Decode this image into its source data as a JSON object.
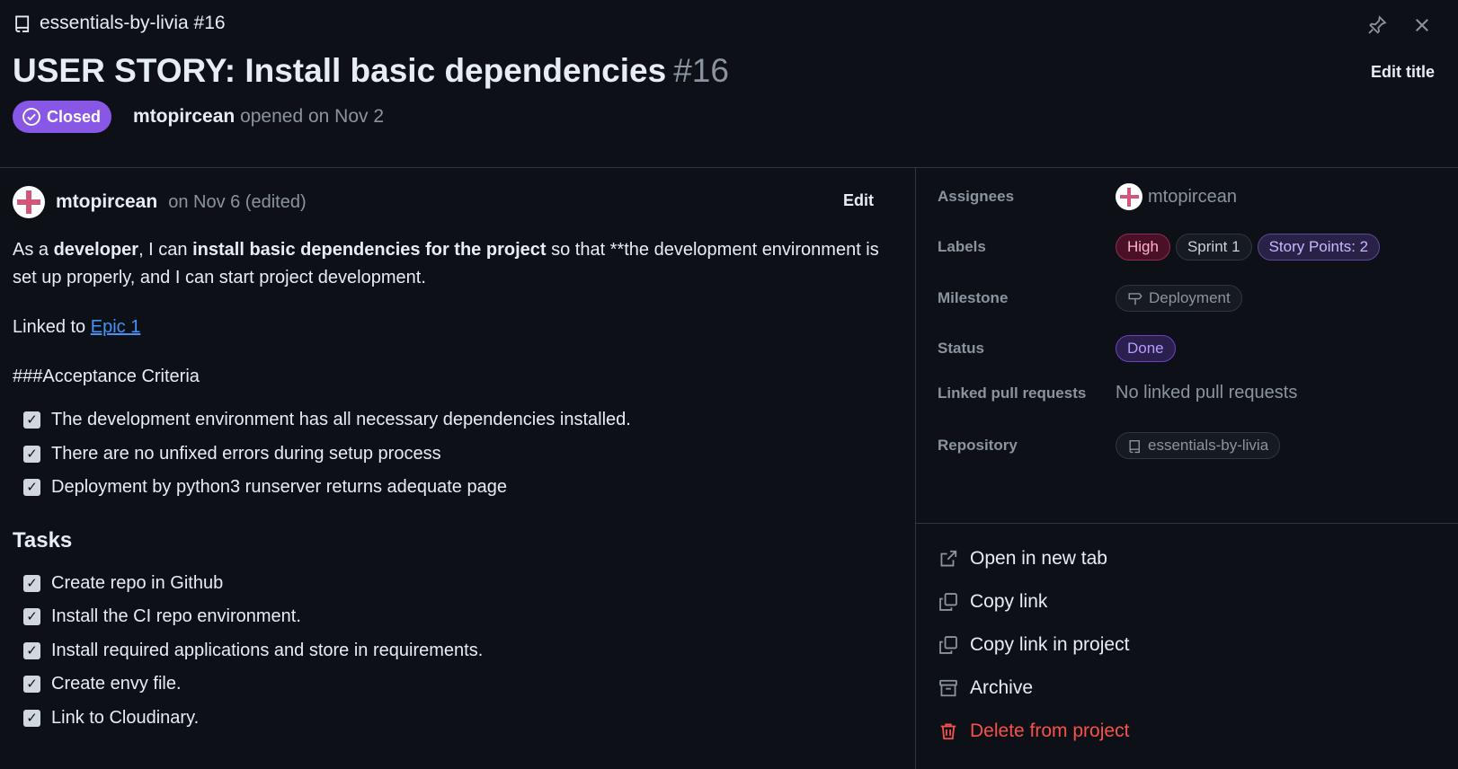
{
  "header": {
    "repo_ref": "essentials-by-livia #16",
    "title": "USER STORY: Install basic dependencies",
    "number": "#16",
    "edit_title": "Edit title",
    "state": "Closed",
    "author": "mtopircean",
    "opened_text": "opened on Nov 2"
  },
  "comment": {
    "author": "mtopircean",
    "date": "on Nov 6 (edited)",
    "edit_label": "Edit",
    "para1": {
      "t1": "As a ",
      "b1": "developer",
      "t2": ", I can ",
      "b2": "install basic dependencies for the project",
      "t3": " so that **the development environment is set up properly, and I can start project development."
    },
    "linked_prefix": "Linked to ",
    "linked_link": "Epic 1",
    "acceptance_heading": "###Acceptance Criteria",
    "criteria": [
      "The development environment has all necessary dependencies installed.",
      "There are no unfixed errors during setup process",
      "Deployment by python3 runserver returns adequate page"
    ],
    "tasks_heading": "Tasks",
    "tasks": [
      "Create repo in Github",
      "Install the CI repo environment.",
      "Install required applications and store in requirements.",
      "Create envy file.",
      "Link to Cloudinary."
    ]
  },
  "sidebar": {
    "assignees_label": "Assignees",
    "assignee": "mtopircean",
    "labels_label": "Labels",
    "labels": [
      "High",
      "Sprint 1",
      "Story Points: 2"
    ],
    "milestone_label": "Milestone",
    "milestone": "Deployment",
    "status_label": "Status",
    "status": "Done",
    "prs_label": "Linked pull requests",
    "prs_value": "No linked pull requests",
    "repo_label": "Repository",
    "repo": "essentials-by-livia"
  },
  "actions": [
    {
      "label": "Open in new tab",
      "icon": "external-link-icon"
    },
    {
      "label": "Copy link",
      "icon": "copy-icon"
    },
    {
      "label": "Copy link in project",
      "icon": "copy-icon"
    },
    {
      "label": "Archive",
      "icon": "archive-icon"
    },
    {
      "label": "Delete from project",
      "icon": "trash-icon"
    }
  ],
  "colors": {
    "background": "#0d1117",
    "closed_badge": "#8957e5",
    "link": "#4493f8",
    "danger": "#f85149"
  }
}
